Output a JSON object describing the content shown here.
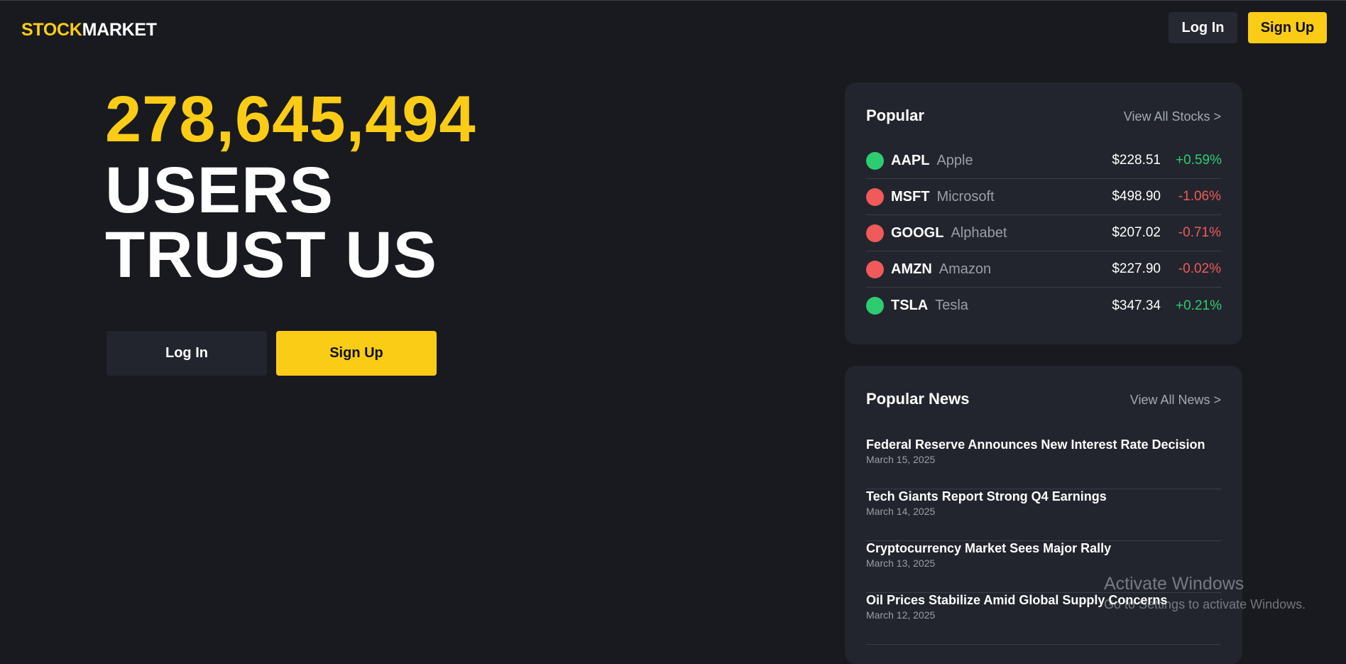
{
  "colors": {
    "accent": "#facc15",
    "up": "#2ecc71",
    "down": "#f05a5a"
  },
  "header": {
    "logo_accent": "STOCK",
    "logo_rest": "MARKET",
    "login_label": "Log In",
    "signup_label": "Sign Up"
  },
  "hero": {
    "count": "278,645,494",
    "line1": "USERS",
    "line2": "TRUST US",
    "login_label": "Log In",
    "signup_label": "Sign Up"
  },
  "popular": {
    "title": "Popular",
    "view_all": "View All Stocks >",
    "stocks": [
      {
        "ticker": "AAPL",
        "company": "Apple",
        "price": "$228.51",
        "change": "+0.59%",
        "direction": "up"
      },
      {
        "ticker": "MSFT",
        "company": "Microsoft",
        "price": "$498.90",
        "change": "-1.06%",
        "direction": "down"
      },
      {
        "ticker": "GOOGL",
        "company": "Alphabet",
        "price": "$207.02",
        "change": "-0.71%",
        "direction": "down"
      },
      {
        "ticker": "AMZN",
        "company": "Amazon",
        "price": "$227.90",
        "change": "-0.02%",
        "direction": "down"
      },
      {
        "ticker": "TSLA",
        "company": "Tesla",
        "price": "$347.34",
        "change": "+0.21%",
        "direction": "up"
      }
    ]
  },
  "news": {
    "title": "Popular News",
    "view_all": "View All News >",
    "items": [
      {
        "title": "Federal Reserve Announces New Interest Rate Decision",
        "date": "March 15, 2025"
      },
      {
        "title": "Tech Giants Report Strong Q4 Earnings",
        "date": "March 14, 2025"
      },
      {
        "title": "Cryptocurrency Market Sees Major Rally",
        "date": "March 13, 2025"
      },
      {
        "title": "Oil Prices Stabilize Amid Global Supply Concerns",
        "date": "March 12, 2025"
      }
    ]
  },
  "watermark": {
    "title": "Activate Windows",
    "subtitle": "Go to Settings to activate Windows."
  }
}
